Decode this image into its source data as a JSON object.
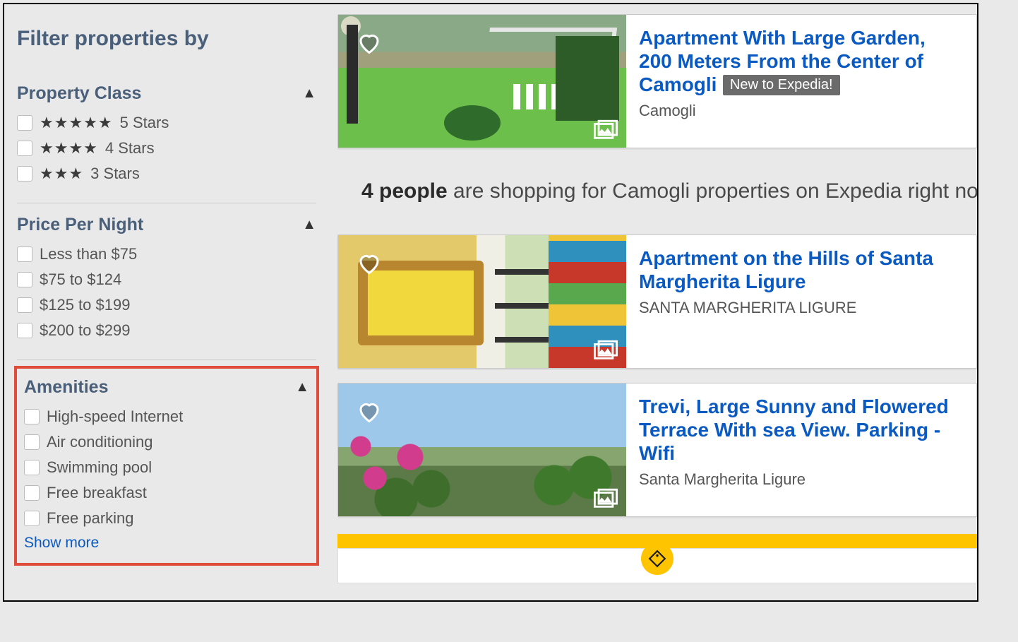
{
  "sidebar": {
    "title": "Filter properties by",
    "property_class": {
      "heading": "Property Class",
      "options": [
        "5 Stars",
        "4 Stars",
        "3 Stars"
      ],
      "star_glyphs": [
        "★★★★★",
        "★★★★",
        "★★★"
      ]
    },
    "price": {
      "heading": "Price Per Night",
      "options": [
        "Less than $75",
        "$75 to $124",
        "$125 to $199",
        "$200 to $299"
      ]
    },
    "amenities": {
      "heading": "Amenities",
      "options": [
        "High-speed Internet",
        "Air conditioning",
        "Swimming pool",
        "Free breakfast",
        "Free parking"
      ],
      "show_more": "Show more"
    }
  },
  "shoppers": {
    "count": "4 people",
    "rest": " are shopping for Camogli properties on Expedia right now"
  },
  "results": [
    {
      "title": "Apartment With Large Garden, 200 Meters From the Center of Camogli",
      "badge": "New to Expedia!",
      "subtitle": "Camogli"
    },
    {
      "title": "Apartment on the Hills of Santa Margherita Ligure",
      "subtitle": "SANTA MARGHERITA LIGURE"
    },
    {
      "title": "Trevi, Large Sunny and Flowered Terrace With sea View. Parking - Wifi",
      "subtitle": "Santa Margherita Ligure"
    }
  ]
}
